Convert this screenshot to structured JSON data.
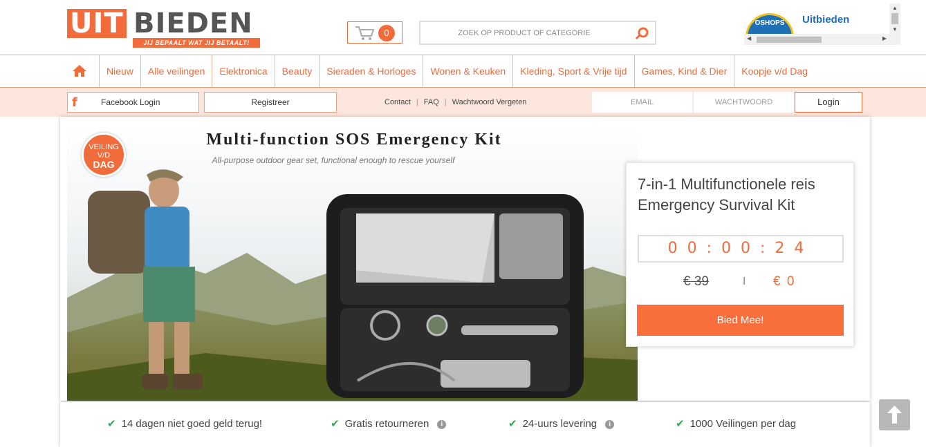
{
  "header": {
    "logo": {
      "part1": "UIT",
      "part2": "BIEDEN",
      "tagline": "JIJ BEPAALT WAT JIJ BETAALT!"
    },
    "cart_count": "0",
    "search_placeholder": "ZOEK OP PRODUCT OF CATEGORIE",
    "oshops": {
      "badge_text": "OSHOPS",
      "name": "Uitbieden"
    }
  },
  "nav": {
    "items": [
      "Nieuw",
      "Alle veilingen",
      "Elektronica",
      "Beauty",
      "Sieraden & Horloges",
      "Wonen & Keuken",
      "Kleding, Sport & Vrije tijd",
      "Games, Kind & Dier",
      "Koopje v/d Dag"
    ]
  },
  "loginbar": {
    "facebook_icon_letter": "f",
    "facebook_label": "Facebook Login",
    "register_label": "Registreer",
    "links": [
      "Contact",
      "FAQ",
      "Wachtwoord Vergeten"
    ],
    "separator": "|",
    "email_placeholder": "EMAIL",
    "password_placeholder": "WACHTWOORD",
    "login_label": "Login"
  },
  "product": {
    "badge": {
      "line1": "VEILING",
      "line2": "V/D",
      "line3": "DAG"
    },
    "image_heading": "Multi-function SOS Emergency Kit",
    "image_subheading": "All-purpose outdoor gear set, functional enough to rescue yourself",
    "title": "7-in-1 Multifunctionele reis Emergency Survival Kit",
    "timer": "00:00:24",
    "old_price": "€ 39",
    "price_separator": "I",
    "current_price": "€ 0",
    "bid_label": "Bied Mee!"
  },
  "usp": {
    "items": [
      "14 dagen niet goed geld terug!",
      "Gratis retourneren",
      "24-uurs levering",
      "1000 Veilingen per dag"
    ],
    "check_icon": "✔",
    "info_icon": "i"
  },
  "colors": {
    "accent": "#f26b3a",
    "login_bar_bg": "#fde6dd",
    "bid_button": "#f96f3b",
    "oshops_blue": "#1f6fb6"
  }
}
